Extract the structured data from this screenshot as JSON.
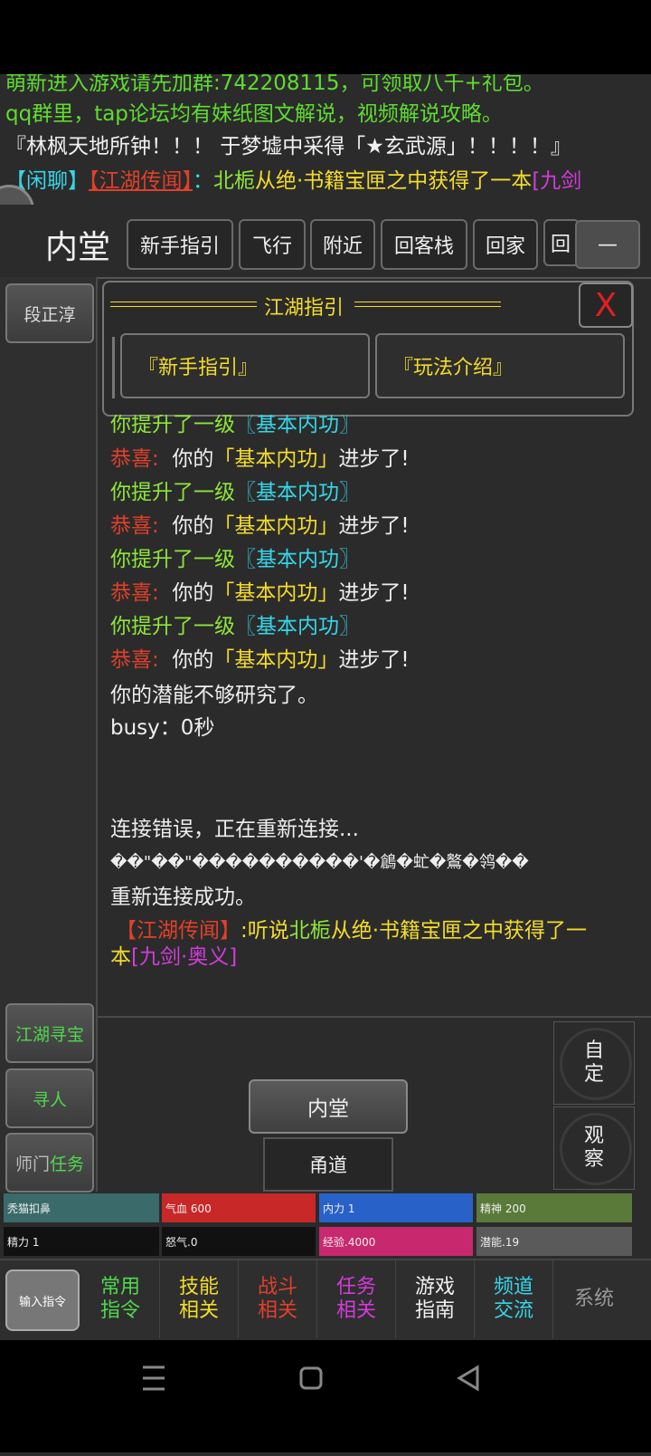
{
  "broadcast": {
    "line1": "萌新进入游戏请先加群:742208115，可领取八千+礼包。",
    "line2": "qq群里，tap论坛均有妹纸图文解说，视频解说攻略。",
    "line3": "『林枫天地所钟！！！ 于梦墟中采得「★玄武源」！！！！』",
    "line4_tag": "【闲聊】",
    "line4_channel": "【江湖传闻】",
    "line4_colon": "：",
    "line4_name": "北栀",
    "line4_text": "从绝·书籍宝匣之中获得了一本",
    "line4_item": "[九剑"
  },
  "roombar": {
    "title": "内堂",
    "buttons": [
      "新手指引",
      "飞行",
      "附近",
      "回客栈",
      "回家",
      "回"
    ],
    "minimize": "—"
  },
  "sidebar": {
    "top": "段正淳",
    "bottom": [
      "江湖寻宝",
      "寻人"
    ],
    "task_prefix": "师门",
    "task_suffix": "任务"
  },
  "guide": {
    "title": "江湖指引",
    "close": "X",
    "btn1": "『新手指引』",
    "btn2": "『玩法介绍』"
  },
  "log": {
    "up_prefix": "你提升了一级",
    "skill": "〖基本内功〗",
    "congrats": "恭喜:",
    "your": "你的",
    "skill2": "「基本内功」",
    "advance": "进步了!",
    "potential": "你的潜能不够研究了。",
    "busy": "busy：0秒",
    "conn_err": "连接错误，正在重新连接...",
    "garbled": "��\"��\"����������'�鶬�虻�鸄�鸰��",
    "reconnected": "重新连接成功。",
    "rumor_channel": "【江湖传闻】",
    "rumor_say": ":听说",
    "rumor_name": "北栀",
    "rumor_text": "从绝·书籍宝匣之中获得了一",
    "rumor_line2_a": "本",
    "rumor_item": "[九剑·奥义]"
  },
  "actions": {
    "neitang": "内堂",
    "yongdao": "甬道",
    "custom_1": "自",
    "custom_2": "定",
    "observe_1": "观",
    "observe_2": "察"
  },
  "stats": {
    "skin": "秃猫扣鼻",
    "qixue": "气血 600",
    "neili": "内力 1",
    "jingshen": "精神 200",
    "jingli": "精力 1",
    "nuqi": "怒气.0",
    "exp": "经验.4000",
    "qianneng": "潜能.19"
  },
  "menu": {
    "input": "输入指令",
    "common_1": "常用",
    "common_2": "指令",
    "skill_1": "技能",
    "skill_2": "相关",
    "fight_1": "战斗",
    "fight_2": "相关",
    "task_1": "任务",
    "task_2": "相关",
    "guide_1": "游戏",
    "guide_2": "指南",
    "channel_1": "频道",
    "channel_2": "交流",
    "system": "系统"
  },
  "colors": {
    "qixue": "#c82828",
    "neili": "#2862c8",
    "jingshen": "#5a7a3a",
    "skin": "#3a6a6a",
    "exp": "#c8286e",
    "qianneng": "#5a5a5a"
  }
}
